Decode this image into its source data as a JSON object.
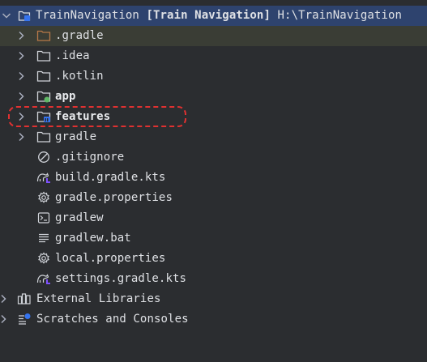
{
  "root": {
    "name": "TrainNavigation",
    "module": "[Train Navigation]",
    "path": "H:\\TrainNavigation"
  },
  "items": [
    {
      "label": ".gradle",
      "icon": "folder-orange-icon"
    },
    {
      "label": ".idea",
      "icon": "folder-icon"
    },
    {
      "label": ".kotlin",
      "icon": "folder-icon"
    },
    {
      "label": "app",
      "icon": "module-folder-icon"
    },
    {
      "label": "features",
      "icon": "module-group-folder-icon"
    },
    {
      "label": "gradle",
      "icon": "folder-icon"
    },
    {
      "label": ".gitignore",
      "icon": "ignore-icon"
    },
    {
      "label": "build.gradle.kts",
      "icon": "gradle-kts-icon"
    },
    {
      "label": "gradle.properties",
      "icon": "gear-icon"
    },
    {
      "label": "gradlew",
      "icon": "terminal-icon"
    },
    {
      "label": "gradlew.bat",
      "icon": "text-file-icon"
    },
    {
      "label": "local.properties",
      "icon": "gear-icon"
    },
    {
      "label": "settings.gradle.kts",
      "icon": "gradle-kts-icon"
    }
  ],
  "bottom": {
    "external_libraries": "External Libraries",
    "scratches": "Scratches and Consoles"
  },
  "colors": {
    "selection": "#2e436e",
    "annotation": "#e03131",
    "folder_orange": "#b87848",
    "module_green": "#5fb865",
    "module_blue": "#3574f0"
  }
}
